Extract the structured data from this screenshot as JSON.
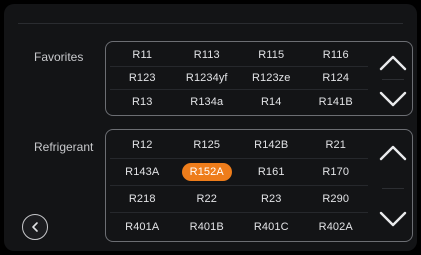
{
  "favorites": {
    "label": "Favorites",
    "items": [
      "R11",
      "R113",
      "R115",
      "R116",
      "R123",
      "R1234yf",
      "R123ze",
      "R124",
      "R13",
      "R134a",
      "R14",
      "R141B"
    ]
  },
  "refrigerant": {
    "label": "Refrigerant",
    "selected": "R152A",
    "items": [
      "R12",
      "R125",
      "R142B",
      "R21",
      "R143A",
      "R152A",
      "R161",
      "R170",
      "R218",
      "R22",
      "R23",
      "R290",
      "R401A",
      "R401B",
      "R401C",
      "R402A"
    ]
  },
  "icons": {
    "scroll_up": "chevron-up-icon",
    "scroll_down": "chevron-down-icon",
    "back": "chevron-left-icon"
  },
  "colors": {
    "accent": "#ee7d1b",
    "background": "#131416",
    "panel_border": "#6c6e73",
    "text": "#e2e3e6"
  }
}
